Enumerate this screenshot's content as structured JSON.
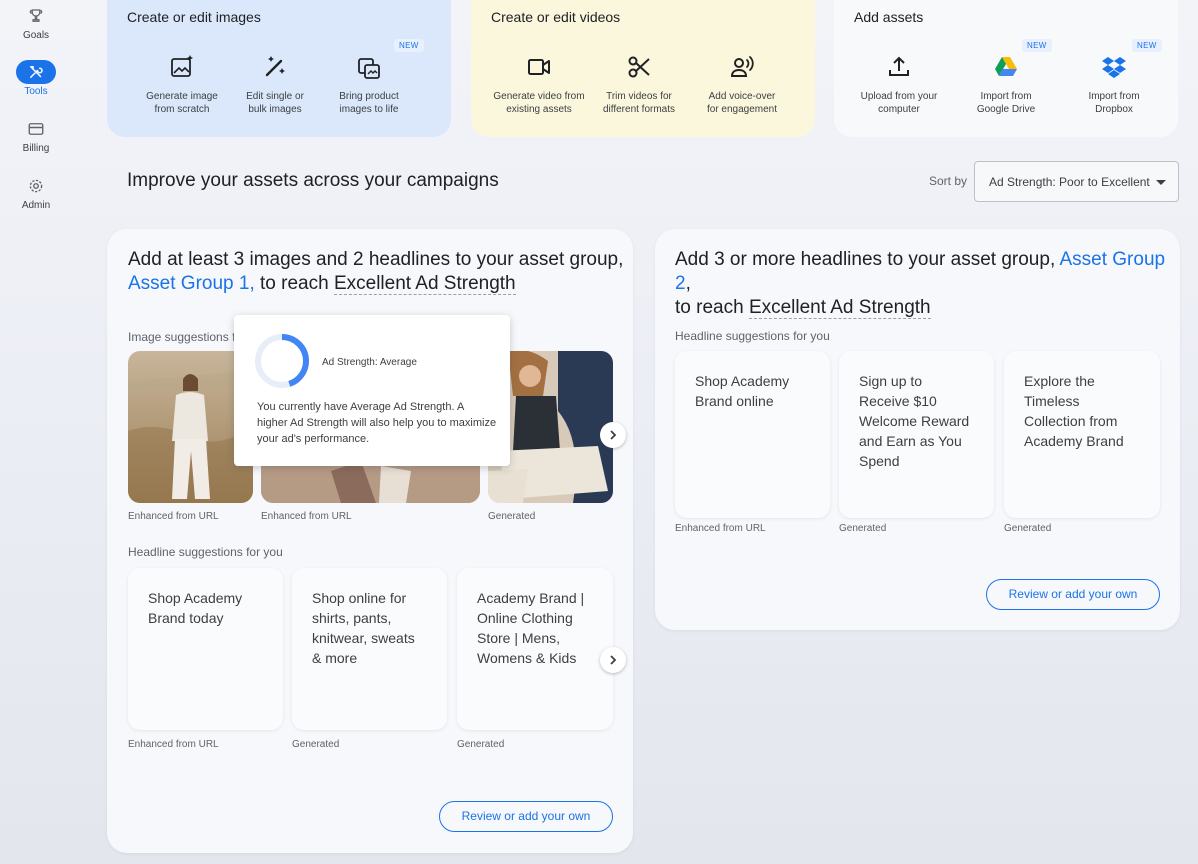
{
  "nav": {
    "items": [
      {
        "label": "Goals",
        "icon": "trophy-icon"
      },
      {
        "label": "Tools",
        "icon": "tools-icon",
        "active": true
      },
      {
        "label": "Billing",
        "icon": "credit-card-icon"
      },
      {
        "label": "Admin",
        "icon": "gear-icon"
      }
    ]
  },
  "top": {
    "images": {
      "title": "Create or edit images",
      "tools": [
        {
          "label": "Generate image\nfrom scratch",
          "icon": "image-sparkle-icon"
        },
        {
          "label": "Edit single or\nbulk images",
          "icon": "magic-wand-icon"
        },
        {
          "label": "Bring product\nimages to life",
          "icon": "product-image-icon",
          "badge": "NEW"
        }
      ]
    },
    "videos": {
      "title": "Create or edit videos",
      "tools": [
        {
          "label": "Generate video from\nexisting assets",
          "icon": "video-camera-icon"
        },
        {
          "label": "Trim videos for\ndifferent formats",
          "icon": "scissors-icon"
        },
        {
          "label": "Add voice-over\nfor engagement",
          "icon": "voice-icon"
        }
      ]
    },
    "assets": {
      "title": "Add assets",
      "tools": [
        {
          "label": "Upload from your\ncomputer",
          "icon": "upload-icon"
        },
        {
          "label": "Import from\nGoogle Drive",
          "icon": "google-drive-icon",
          "badge": "NEW"
        },
        {
          "label": "Import from\nDropbox",
          "icon": "dropbox-icon",
          "badge": "NEW"
        }
      ]
    }
  },
  "section": {
    "title": "Improve your assets across your campaigns",
    "sort_label": "Sort by",
    "sort_value": "Ad Strength: Poor to Excellent"
  },
  "card1": {
    "head_pre": "Add at least 3 images and 2 headlines to your asset group,",
    "group_link": "Asset Group 1,",
    "head_mid": " to reach ",
    "strength_link": "Excellent Ad Strength",
    "image_sub": "Image suggestions f",
    "image_caps": [
      "Enhanced from URL",
      "Enhanced from URL",
      "Generated"
    ],
    "headline_sub": "Headline suggestions for you",
    "headlines": [
      "Shop Academy Brand today",
      "Shop online for shirts, pants, knitwear, sweats & more",
      "Academy Brand | Online Clothing Store | Mens, Womens & Kids"
    ],
    "headline_caps": [
      "Enhanced from URL",
      "Generated",
      "Generated"
    ],
    "button": "Review or add your own"
  },
  "card2": {
    "head_pre": "Add 3 or more headlines to your asset group,",
    "group_link": "Asset Group 2",
    "head_comma": ",",
    "head_mid": "to reach ",
    "strength_link": "Excellent Ad Strength",
    "headline_sub": "Headline suggestions for you",
    "headlines": [
      "Shop Academy Brand online",
      "Sign up to Receive $10 Welcome Reward and Earn as You Spend",
      "Explore the Timeless Collection from Academy Brand"
    ],
    "headline_caps": [
      "Enhanced from URL",
      "Generated",
      "Generated"
    ],
    "button": "Review or add your own"
  },
  "popover": {
    "title": "Ad Strength: Average",
    "body": "You currently have Average Ad Strength. A higher Ad Strength will also help you to maximize your ad's performance.",
    "strength_fraction": 0.45
  },
  "colors": {
    "accent": "#1a73e8",
    "images_card": "#dbe8fb",
    "videos_card": "#fbf7dd",
    "assets_card": "#f8f9fb"
  }
}
